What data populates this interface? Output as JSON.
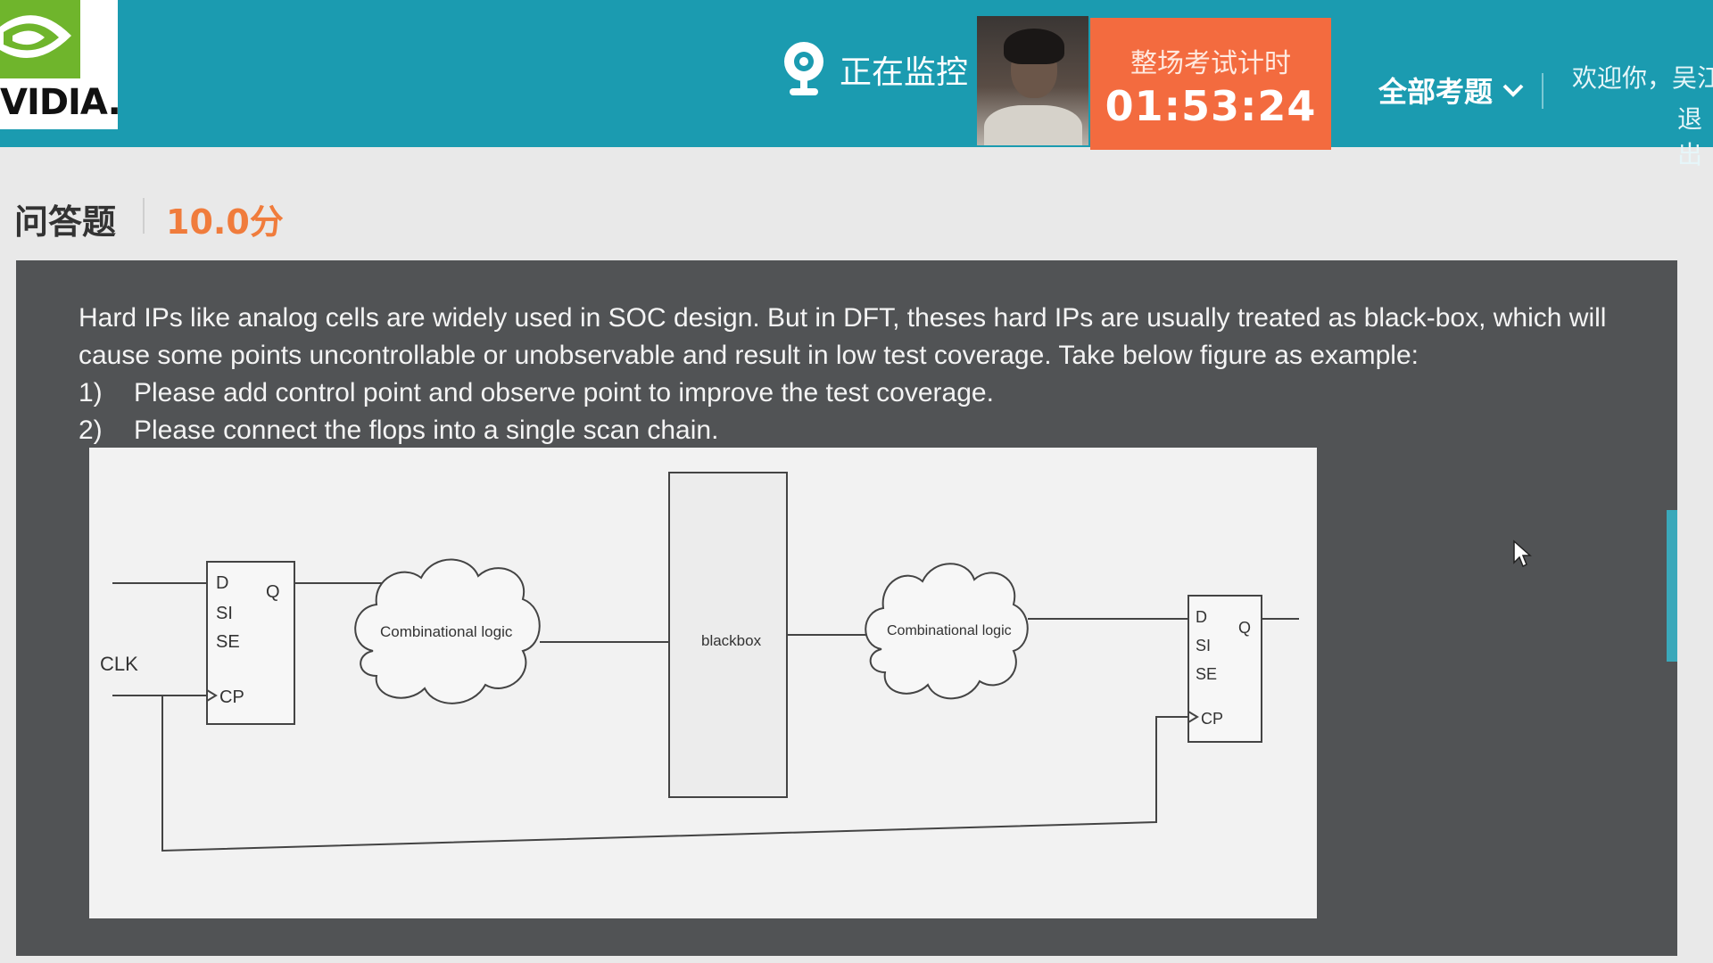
{
  "header": {
    "logo_text": "VIDIA.",
    "monitor_label": "正在监控",
    "timer_label": "整场考试计时",
    "timer_value": "01:53:24",
    "all_questions_label": "全部考题",
    "welcome_text": "欢迎你，吴江平",
    "logout_label": "退出"
  },
  "question": {
    "type_label": "问答题",
    "score": "10.0分",
    "intro": "Hard IPs like analog cells are widely used in SOC design. But in DFT, theses hard IPs are usually treated as black-box, which will cause some points uncontrollable or unobservable and result in low test coverage. Take below figure as example:",
    "items": [
      {
        "num": "1)",
        "text": "Please add control point and observe point to improve the test coverage."
      },
      {
        "num": "2)",
        "text": "Please connect the flops into a single scan chain."
      }
    ]
  },
  "diagram": {
    "clk_label": "CLK",
    "flop_left": {
      "d": "D",
      "si": "SI",
      "se": "SE",
      "cp": "CP",
      "q": "Q"
    },
    "cloud_left": "Combinational logic",
    "blackbox": "blackbox",
    "cloud_right": "Combinational logic",
    "flop_right": {
      "d": "D",
      "si": "SI",
      "se": "SE",
      "cp": "CP",
      "q": "Q"
    }
  },
  "colors": {
    "header": "#1b9bb0",
    "timer": "#f36b3f",
    "score": "#f07c3c",
    "panel": "#515355",
    "logo_green": "#6fb52c"
  }
}
